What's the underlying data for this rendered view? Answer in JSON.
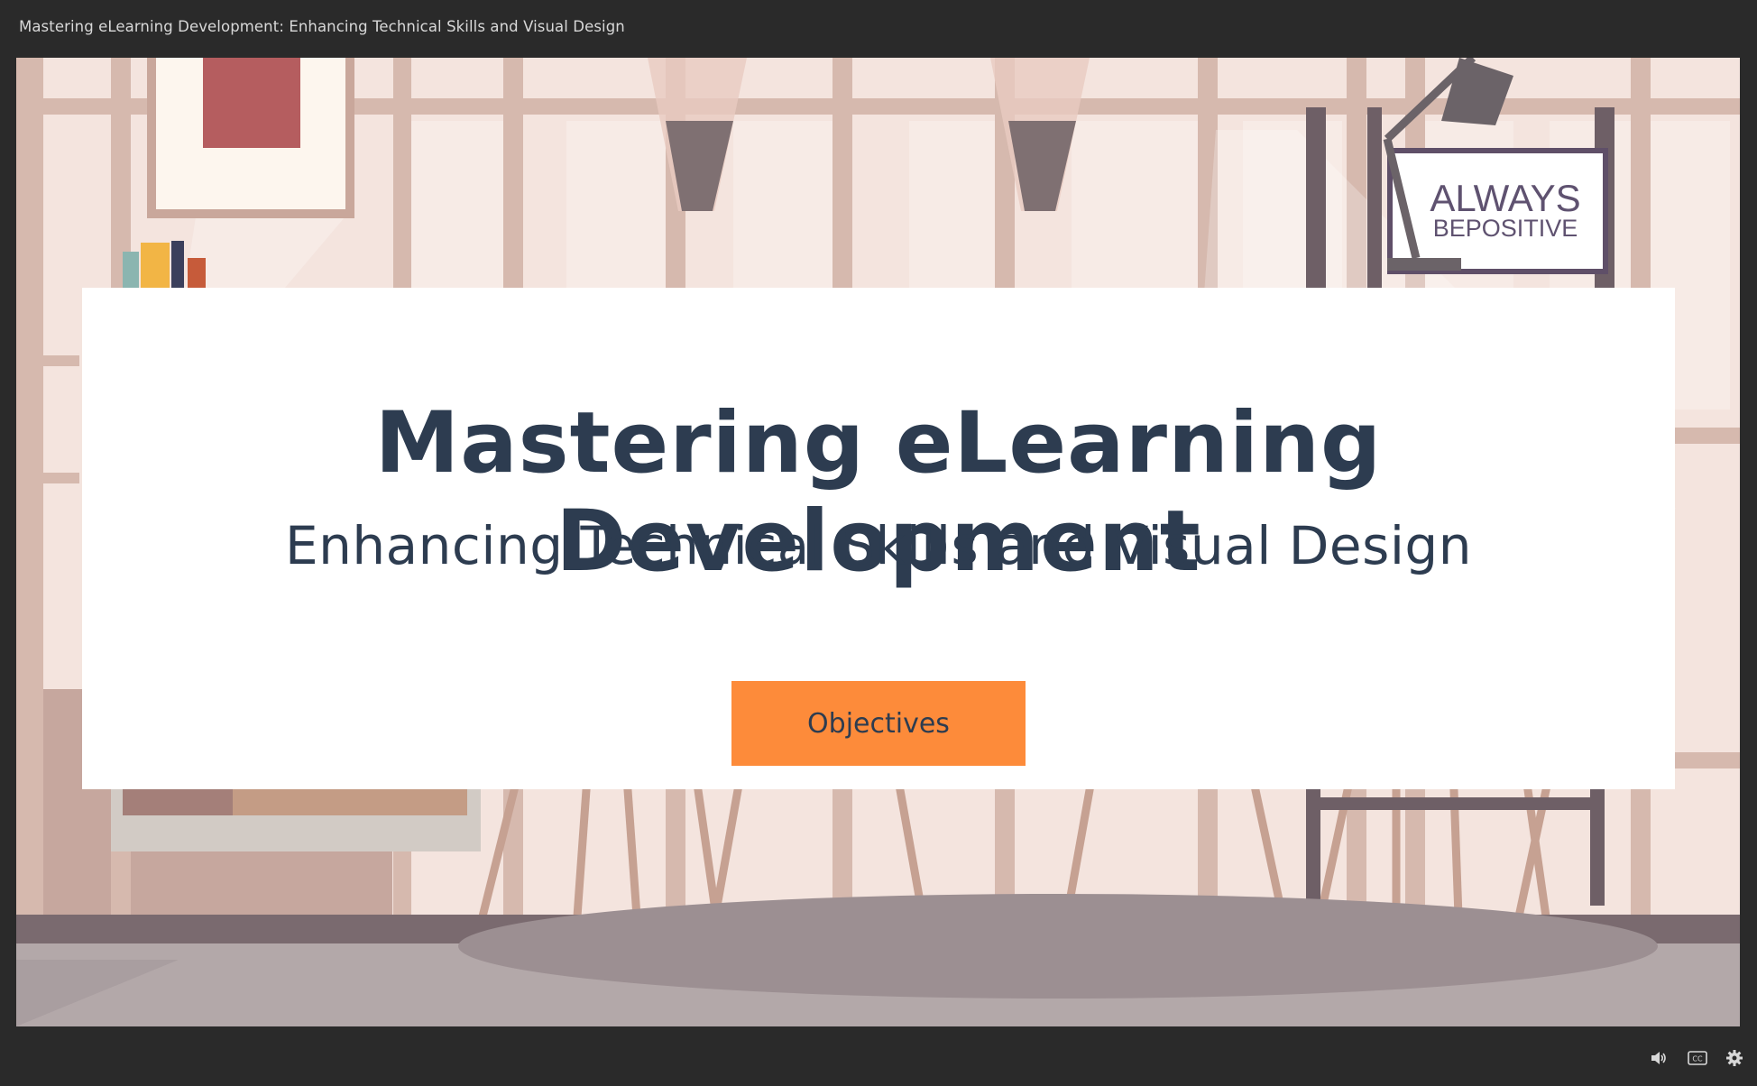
{
  "window": {
    "title": "Mastering eLearning Development: Enhancing Technical Skills and Visual Design"
  },
  "slide": {
    "heading": "Mastering eLearning Development",
    "subheading": "Enhancing Technical Skills and Visual Design",
    "button_label": "Objectives",
    "sign_line1": "ALWAYS",
    "sign_line2": "BEPOSITIVE"
  },
  "controls": {
    "volume_icon": "volume-icon",
    "captions_icon": "closed-captions-icon",
    "settings_icon": "gear-icon"
  },
  "colors": {
    "accent": "#fd8b3a",
    "text": "#2d3c50",
    "chrome": "#2a2a2a"
  }
}
